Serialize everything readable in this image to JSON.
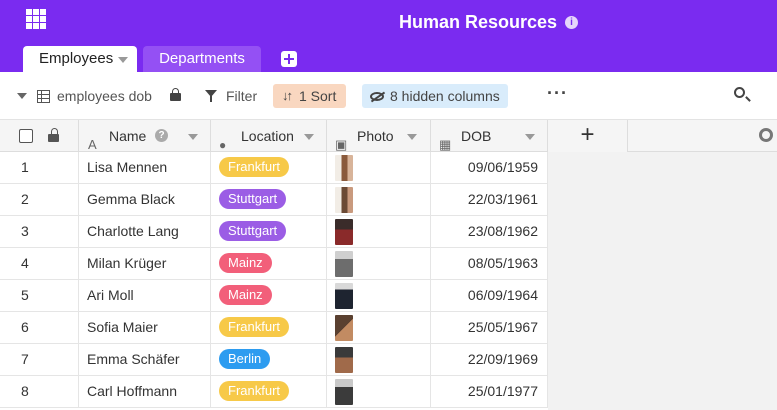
{
  "header": {
    "title": "Human Resources",
    "tabs": [
      {
        "label": "Employees",
        "active": true
      },
      {
        "label": "Departments",
        "active": false
      }
    ]
  },
  "toolbar": {
    "view_name": "employees dob",
    "filter_label": "Filter",
    "sort_label": "1 Sort",
    "hidden_label": "8 hidden columns",
    "more_label": "···"
  },
  "columns": {
    "name": "Name",
    "location": "Location",
    "photo": "Photo",
    "dob": "DOB",
    "add_label": "+"
  },
  "colors": {
    "brand": "#7a2bf0",
    "frankfurt": "#f7c948",
    "stuttgart": "#9b5de5",
    "mainz": "#f25f7a",
    "berlin": "#2d9cf0"
  },
  "rows": [
    {
      "num": "1",
      "name": "Lisa Mennen",
      "location": "Frankfurt",
      "dob": "09/06/1959",
      "photo_icon": "portrait-photo"
    },
    {
      "num": "2",
      "name": "Gemma Black",
      "location": "Stuttgart",
      "dob": "22/03/1961",
      "photo_icon": "portrait-photo"
    },
    {
      "num": "3",
      "name": "Charlotte Lang",
      "location": "Stuttgart",
      "dob": "23/08/1962",
      "photo_icon": "portrait-photo"
    },
    {
      "num": "4",
      "name": "Milan Krüger",
      "location": "Mainz",
      "dob": "08/05/1963",
      "photo_icon": "portrait-photo"
    },
    {
      "num": "5",
      "name": "Ari Moll",
      "location": "Mainz",
      "dob": "06/09/1964",
      "photo_icon": "portrait-photo"
    },
    {
      "num": "6",
      "name": "Sofia Maier",
      "location": "Frankfurt",
      "dob": "25/05/1967",
      "photo_icon": "portrait-photo"
    },
    {
      "num": "7",
      "name": "Emma Schäfer",
      "location": "Berlin",
      "dob": "22/09/1969",
      "photo_icon": "portrait-photo"
    },
    {
      "num": "8",
      "name": "Carl Hoffmann",
      "location": "Frankfurt",
      "dob": "25/01/1977",
      "photo_icon": "portrait-photo"
    }
  ]
}
